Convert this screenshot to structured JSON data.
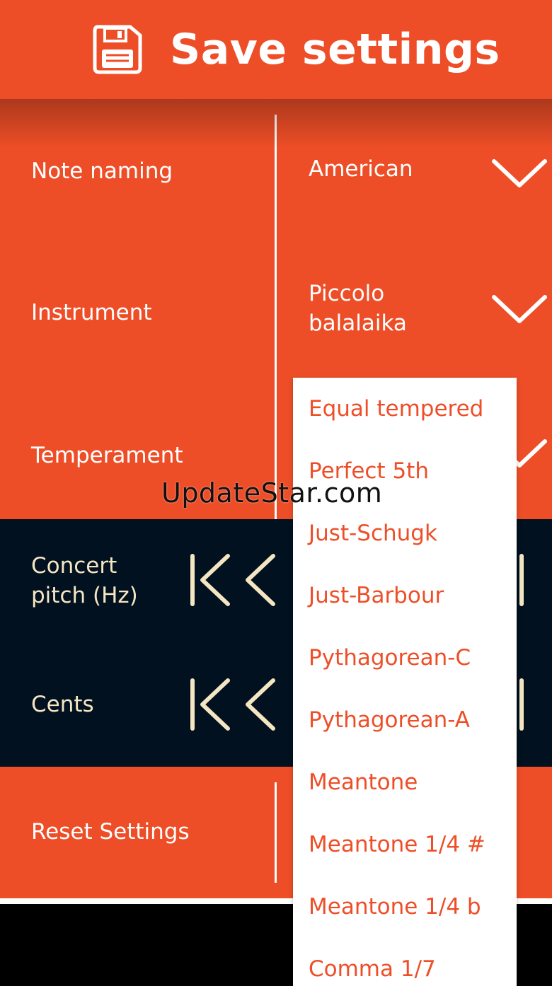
{
  "header": {
    "title": "Save settings",
    "icon": "floppy-disk-icon"
  },
  "settings": {
    "note_naming": {
      "label": "Note naming",
      "value": "American"
    },
    "instrument": {
      "label": "Instrument",
      "value_line1": "Piccolo",
      "value_line2": "balalaika"
    },
    "temperament": {
      "label": "Temperament"
    },
    "concert_pitch": {
      "label_line1": "Concert",
      "label_line2": "pitch (Hz)"
    },
    "cents": {
      "label": "Cents"
    },
    "reset": {
      "label": "Reset Settings"
    }
  },
  "temperament_options": [
    "Equal tempered",
    "Perfect 5th",
    "Just-Schugk",
    "Just-Barbour",
    "Pythagorean-C",
    "Pythagorean-A",
    "Meantone",
    "Meantone 1/4 #",
    "Meantone 1/4 b",
    "Comma 1/7"
  ],
  "watermark": "UpdateStar.com",
  "colors": {
    "accent": "#EE4E27",
    "dark_panel": "#02111F",
    "cream": "#F5E6C3",
    "white": "#FFFFFF"
  }
}
